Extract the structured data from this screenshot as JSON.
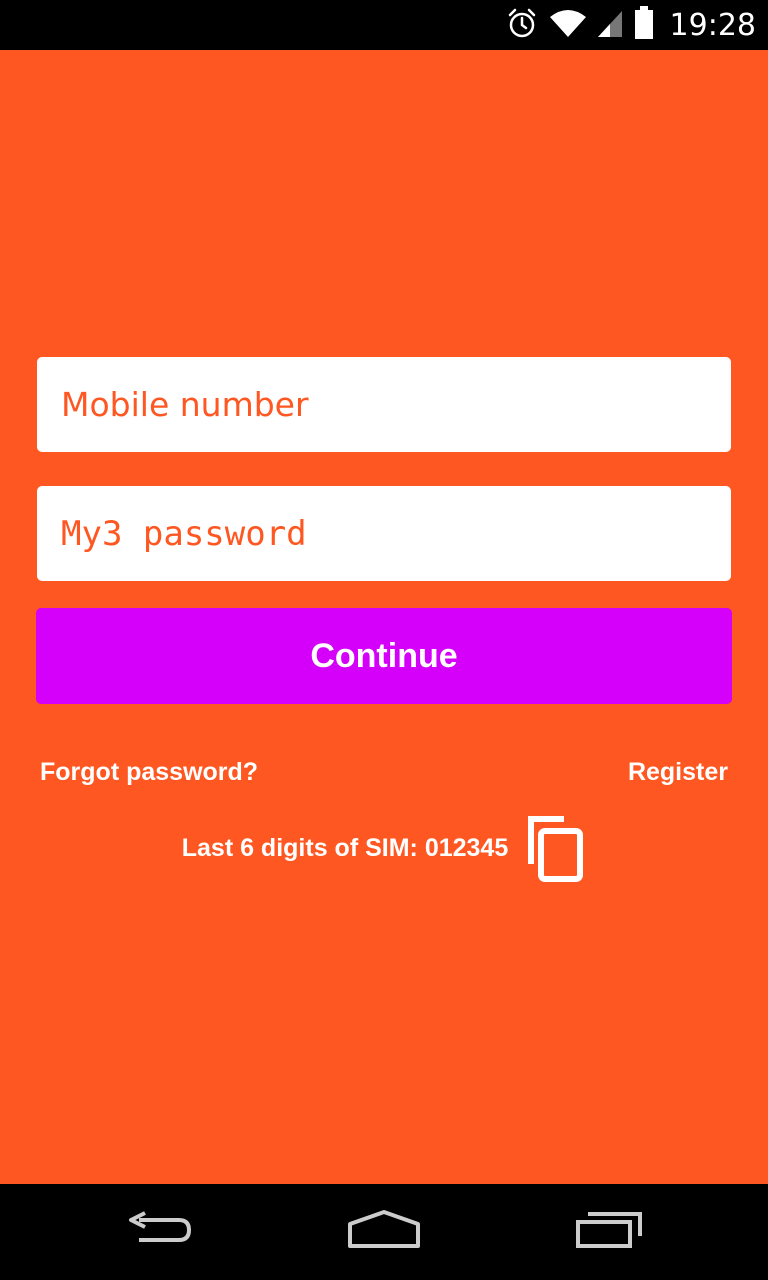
{
  "status_bar": {
    "time": "19:28",
    "icons": [
      "alarm-icon",
      "wifi-icon",
      "signal-icon",
      "battery-icon"
    ]
  },
  "login": {
    "mobile_placeholder": "Mobile number",
    "password_placeholder": "My3 password",
    "continue_label": "Continue",
    "forgot_label": "Forgot password?",
    "register_label": "Register",
    "sim_label": "Last 6 digits of SIM:",
    "sim_value": "012345",
    "copy_icon": "copy-icon"
  },
  "nav_bar": {
    "icons": [
      "back-icon",
      "home-icon",
      "recents-icon"
    ]
  },
  "colors": {
    "background": "#ff5722",
    "button": "#d500f9",
    "field": "#ffffff",
    "placeholder": "#ff5722"
  }
}
